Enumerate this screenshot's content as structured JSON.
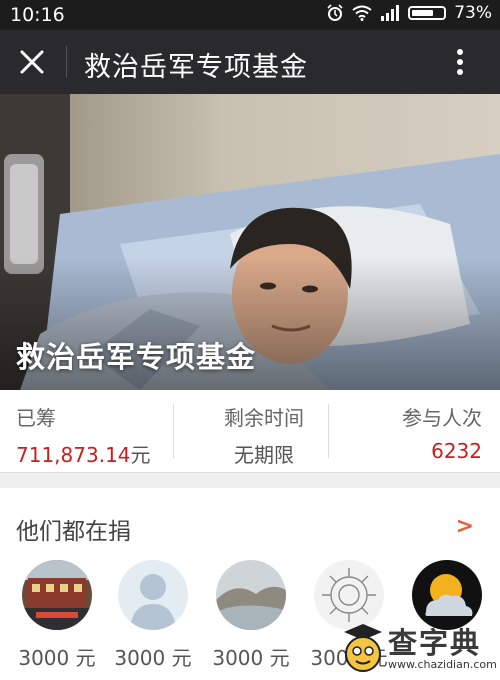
{
  "status_bar": {
    "time": "10:16",
    "battery": "73%",
    "battery_level": 0.73,
    "icons": [
      "alarm-icon",
      "wifi-icon",
      "signal-icon",
      "battery-icon"
    ]
  },
  "nav": {
    "title": "救治岳军专项基金",
    "close_icon": "close-icon",
    "more_icon": "more-vertical-icon"
  },
  "hero": {
    "title": "救治岳军专项基金"
  },
  "stats": {
    "raised": {
      "label": "已筹",
      "amount": "711,873.14",
      "unit": "元"
    },
    "remaining": {
      "label": "剩余时间",
      "value": "无期限"
    },
    "participants": {
      "label": "参与人次",
      "value": "6232"
    }
  },
  "donors": {
    "title": "他们都在捐",
    "more": ">",
    "items": [
      {
        "amount": "3000 元",
        "avatar": "building-photo"
      },
      {
        "amount": "3000 元",
        "avatar": "default-person-icon"
      },
      {
        "amount": "3000 元",
        "avatar": "landscape-photo"
      },
      {
        "amount": "3000 元",
        "avatar": "sunflower-sketch"
      },
      {
        "amount": "",
        "avatar": "weather-icon"
      }
    ]
  },
  "watermark": {
    "text": "查字典",
    "url": "www.chazidian.com"
  },
  "colors": {
    "accent_red": "#c81e1e",
    "more_orange": "#e8603c",
    "navbar": "#2a2a2c"
  }
}
